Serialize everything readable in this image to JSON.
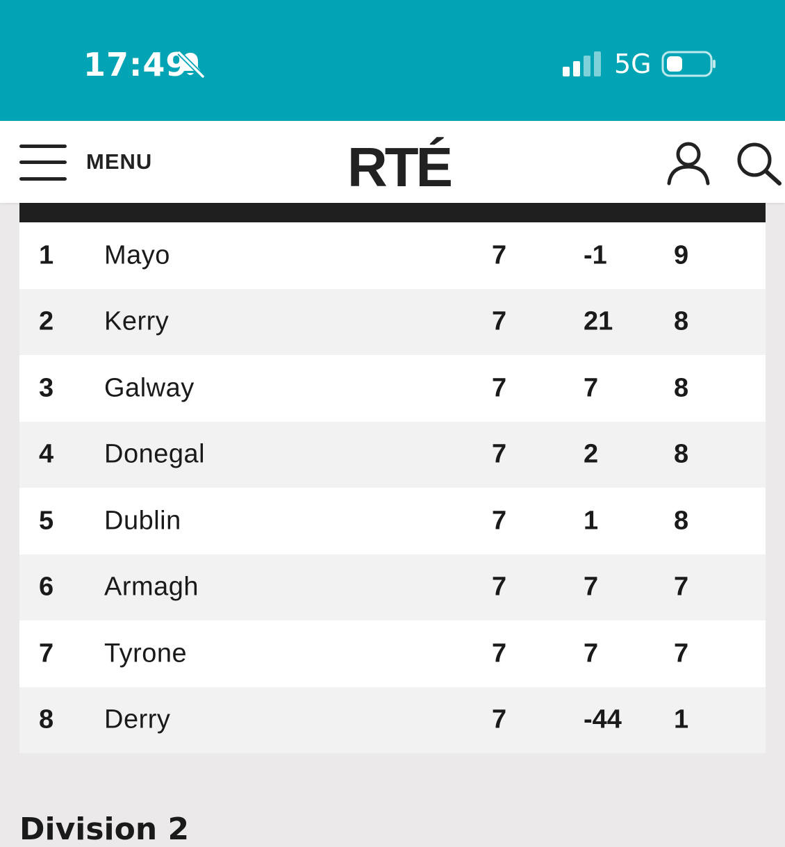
{
  "status_bar": {
    "time": "17:49",
    "network": "5G",
    "bell_icon": "bell-slash-icon",
    "signal_icon": "cellular-signal-icon",
    "battery_icon": "battery-icon",
    "background": "#00a4b4"
  },
  "header": {
    "menu_label": "MENU",
    "logo_text": "RTÉ"
  },
  "table": {
    "rows": [
      {
        "pos": "1",
        "team": "Mayo",
        "played": "7",
        "diff": "-1",
        "pts": "9"
      },
      {
        "pos": "2",
        "team": "Kerry",
        "played": "7",
        "diff": "21",
        "pts": "8"
      },
      {
        "pos": "3",
        "team": "Galway",
        "played": "7",
        "diff": "7",
        "pts": "8"
      },
      {
        "pos": "4",
        "team": "Donegal",
        "played": "7",
        "diff": "2",
        "pts": "8"
      },
      {
        "pos": "5",
        "team": "Dublin",
        "played": "7",
        "diff": "1",
        "pts": "8"
      },
      {
        "pos": "6",
        "team": "Armagh",
        "played": "7",
        "diff": "7",
        "pts": "7"
      },
      {
        "pos": "7",
        "team": "Tyrone",
        "played": "7",
        "diff": "7",
        "pts": "7"
      },
      {
        "pos": "8",
        "team": "Derry",
        "played": "7",
        "diff": "-44",
        "pts": "1"
      }
    ]
  },
  "next_section": {
    "heading": "Division 2"
  }
}
